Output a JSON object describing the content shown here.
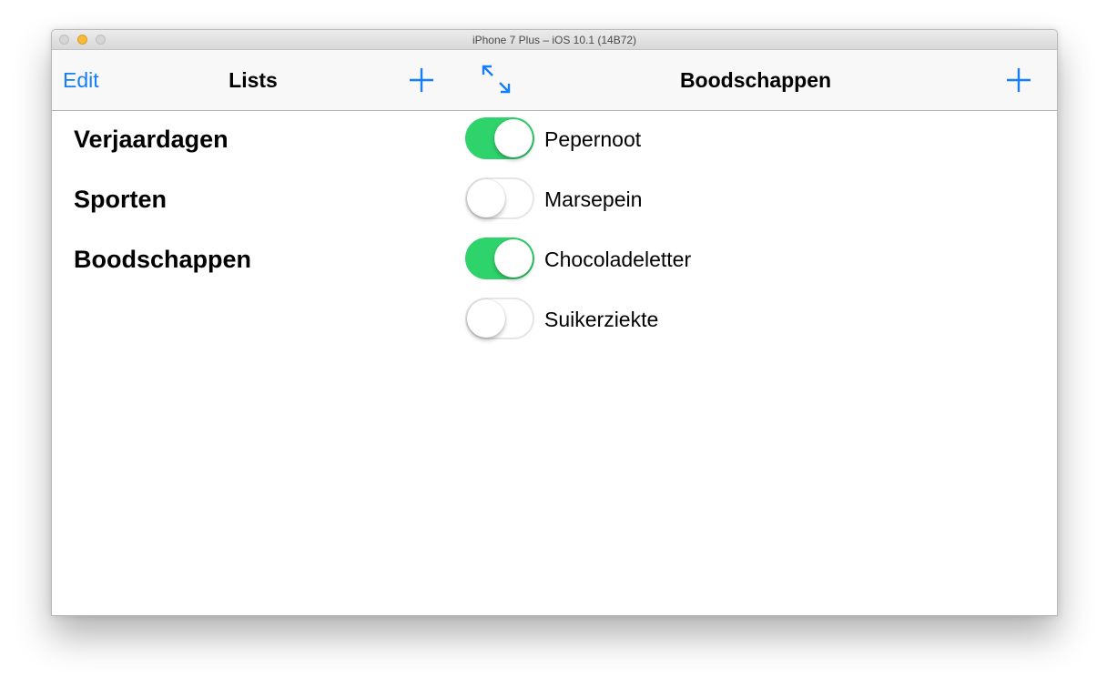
{
  "window": {
    "title": "iPhone 7 Plus – iOS 10.1 (14B72)"
  },
  "master": {
    "edit_label": "Edit",
    "title": "Lists",
    "add_icon": "plus-icon",
    "lists": [
      {
        "label": "Verjaardagen"
      },
      {
        "label": "Sporten"
      },
      {
        "label": "Boodschappen"
      }
    ]
  },
  "detail": {
    "expand_icon": "expand-arrows-icon",
    "title": "Boodschappen",
    "add_icon": "plus-icon",
    "items": [
      {
        "label": "Pepernoot",
        "checked": true
      },
      {
        "label": "Marsepein",
        "checked": false
      },
      {
        "label": "Chocoladeletter",
        "checked": true
      },
      {
        "label": "Suikerziekte",
        "checked": false
      }
    ]
  },
  "colors": {
    "tint": "#157efb",
    "switch_on": "#2fd36b"
  }
}
